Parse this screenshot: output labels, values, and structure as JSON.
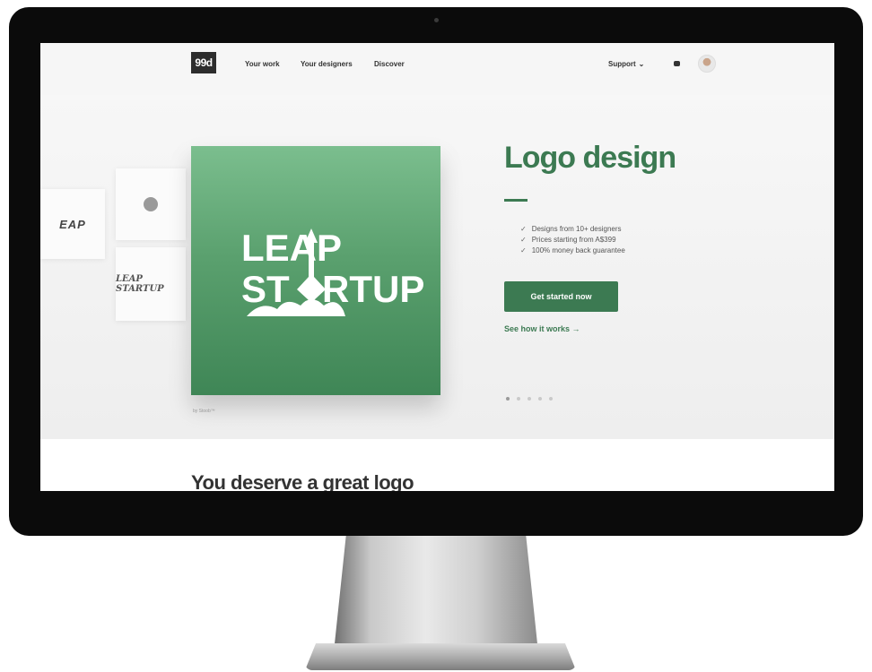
{
  "nav": {
    "logo": "99d",
    "links": [
      "Your work",
      "Your designers",
      "Discover"
    ],
    "support": "Support",
    "support_chevron": "⌄"
  },
  "hero": {
    "thumb_eap": "EAP",
    "thumb_script": "LEAP STARTUP",
    "feature_logo": {
      "line1": "LEAP",
      "line2": "ST",
      "line3": "RTUP"
    },
    "byline": "by Stoob™",
    "title": "Logo design",
    "features": [
      "Designs from 10+ designers",
      "Prices starting from A$399",
      "100% money back guarantee"
    ],
    "check_glyph": "✓",
    "cta": "Get started now",
    "how_link": "See how it works →",
    "slide_count": 5,
    "active_slide": 1
  },
  "section": {
    "title": "You deserve a great logo"
  },
  "colors": {
    "brand_green": "#3c7a52",
    "tile_green": "#5aa06e",
    "bezel": "#0b0b0b"
  }
}
